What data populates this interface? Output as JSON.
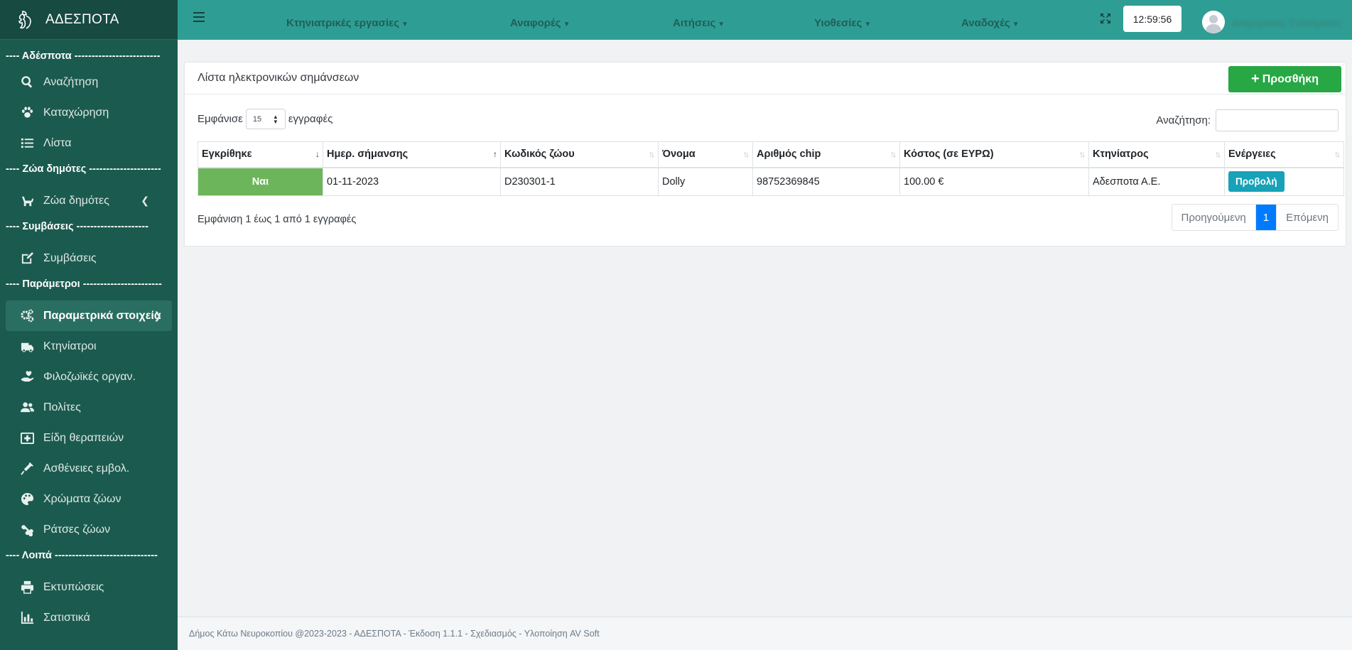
{
  "brand": {
    "title": "ΑΔΕΣΠΟΤΑ",
    "logo_icon": "dog-logo-icon"
  },
  "sidebar": {
    "sections": [
      {
        "header": "---- Αδέσποτα -------------------------"
      },
      {
        "header": "---- Ζώα δημότες ---------------------"
      },
      {
        "header": "---- Συμβάσεις ---------------------"
      },
      {
        "header": "---- Παράμετροι -----------------------"
      },
      {
        "header": "---- Λοιπά ------------------------------"
      }
    ],
    "items": [
      {
        "label": "Αναζήτηση",
        "icon": "search-icon"
      },
      {
        "label": "Καταχώρηση",
        "icon": "paw-icon"
      },
      {
        "label": "Λίστα",
        "icon": "list-icon"
      },
      {
        "label": "Ζώα δημότες",
        "icon": "dog-icon"
      },
      {
        "label": "Συμβάσεις",
        "icon": "edit-icon"
      },
      {
        "label": "Παραμετρικά στοιχεία",
        "icon": "cogs-icon"
      },
      {
        "label": "Κτηνίατροι",
        "icon": "ambulance-icon"
      },
      {
        "label": "Φιλοζωϊκές οργαν.",
        "icon": "hand-heart-icon"
      },
      {
        "label": "Πολίτες",
        "icon": "users-icon"
      },
      {
        "label": "Είδη θεραπειών",
        "icon": "medkit-icon"
      },
      {
        "label": "Ασθένειες εμβολ.",
        "icon": "syringe-icon"
      },
      {
        "label": "Χρώματα ζώων",
        "icon": "palette-icon"
      },
      {
        "label": "Ράτσες ζώων",
        "icon": "bone-icon"
      },
      {
        "label": "Εκτυπώσεις",
        "icon": "print-icon"
      },
      {
        "label": "Σατιστικά",
        "icon": "chart-icon"
      }
    ]
  },
  "topbar": {
    "menus": [
      "Κτηνιατρικές εργασίες",
      "Αναφορές",
      "Αιτήσεις",
      "Υιοθεσίες",
      "Αναδοχές"
    ],
    "clock": "12:59:56",
    "user_name": "Διαχειριστής Συστήματος"
  },
  "card": {
    "title": "Λίστα ηλεκτρονικών σημάνσεων",
    "add_label": "Προσθήκη",
    "show_prefix": "Εμφάνισε",
    "show_value": "15",
    "show_suffix": "εγγραφές",
    "search_label": "Αναζήτηση:",
    "columns": [
      "Εγκρίθηκε",
      "Ημερ. σήμανσης",
      "Κωδικός ζώου",
      "Όνομα",
      "Αριθμός chip",
      "Κόστος (σε ΕΥΡΩ)",
      "Κτηνίατρος",
      "Ενέργειες"
    ],
    "rows": [
      {
        "approved": "Ναι",
        "date": "01-11-2023",
        "code": "D230301-1",
        "name": "Dolly",
        "chip": "98752369845",
        "cost": "100.00 €",
        "vet": "Αδεσποτα Α.Ε.",
        "action": "Προβολή"
      }
    ],
    "info": "Εμφάνιση 1 έως 1 από 1 εγγραφές",
    "pager": {
      "prev": "Προηγούμενη",
      "current": "1",
      "next": "Επόμενη"
    }
  },
  "footer": "Δήμος Κάτω Νευροκοπίου @2023-2023 - ΑΔΕΣΠΟΤΑ - Έκδοση 1.1.1 - Σχεδιασμός - Υλοποίηση AV Soft",
  "colors": {
    "sidebar": "#1b5a4f",
    "topbar": "#2e9e95",
    "add_button": "#28a745",
    "approved": "#6db55a",
    "view_button": "#17a2b8",
    "pager_active": "#007bff"
  }
}
